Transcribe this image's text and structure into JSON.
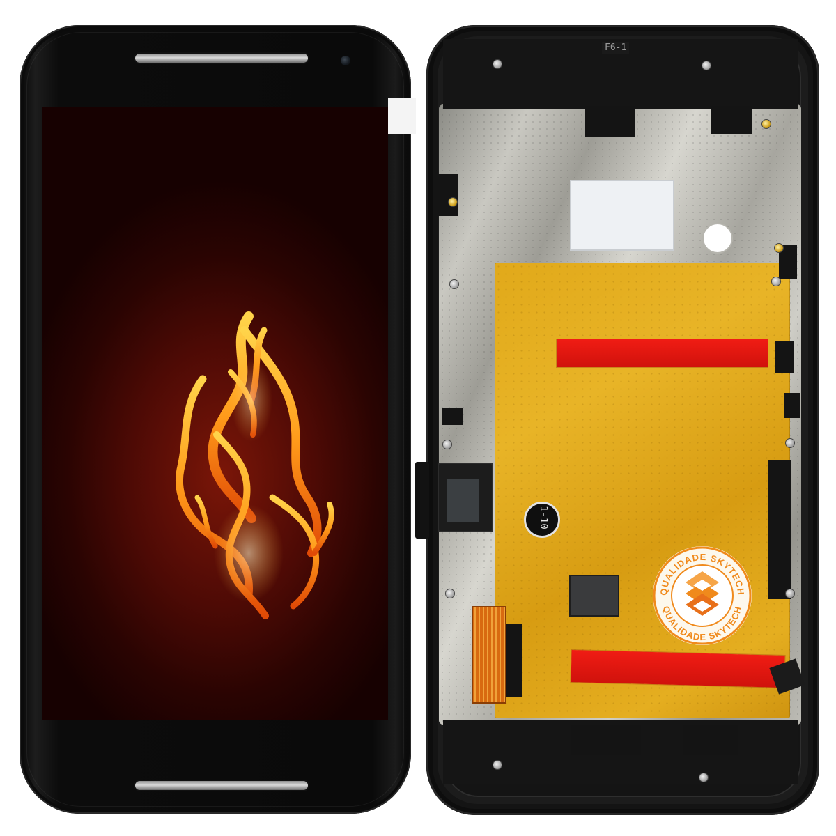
{
  "image": {
    "subject": "phone-display-assembly",
    "views": [
      "front",
      "back"
    ]
  },
  "front": {
    "screen_wallpaper": "flame"
  },
  "back": {
    "part_markings": [
      "F6-1",
      "1-10"
    ]
  },
  "seal": {
    "ring_text_top": "QUALIDADE SKYTECH",
    "ring_text_bottom": "QUALIDADE SKYTECH",
    "brand_color": "#f08a1c"
  },
  "colors": {
    "bezel": "#0a0a0a",
    "screen_center": "#7a1608",
    "film": "#e1a91a",
    "tape": "#e3150f"
  }
}
